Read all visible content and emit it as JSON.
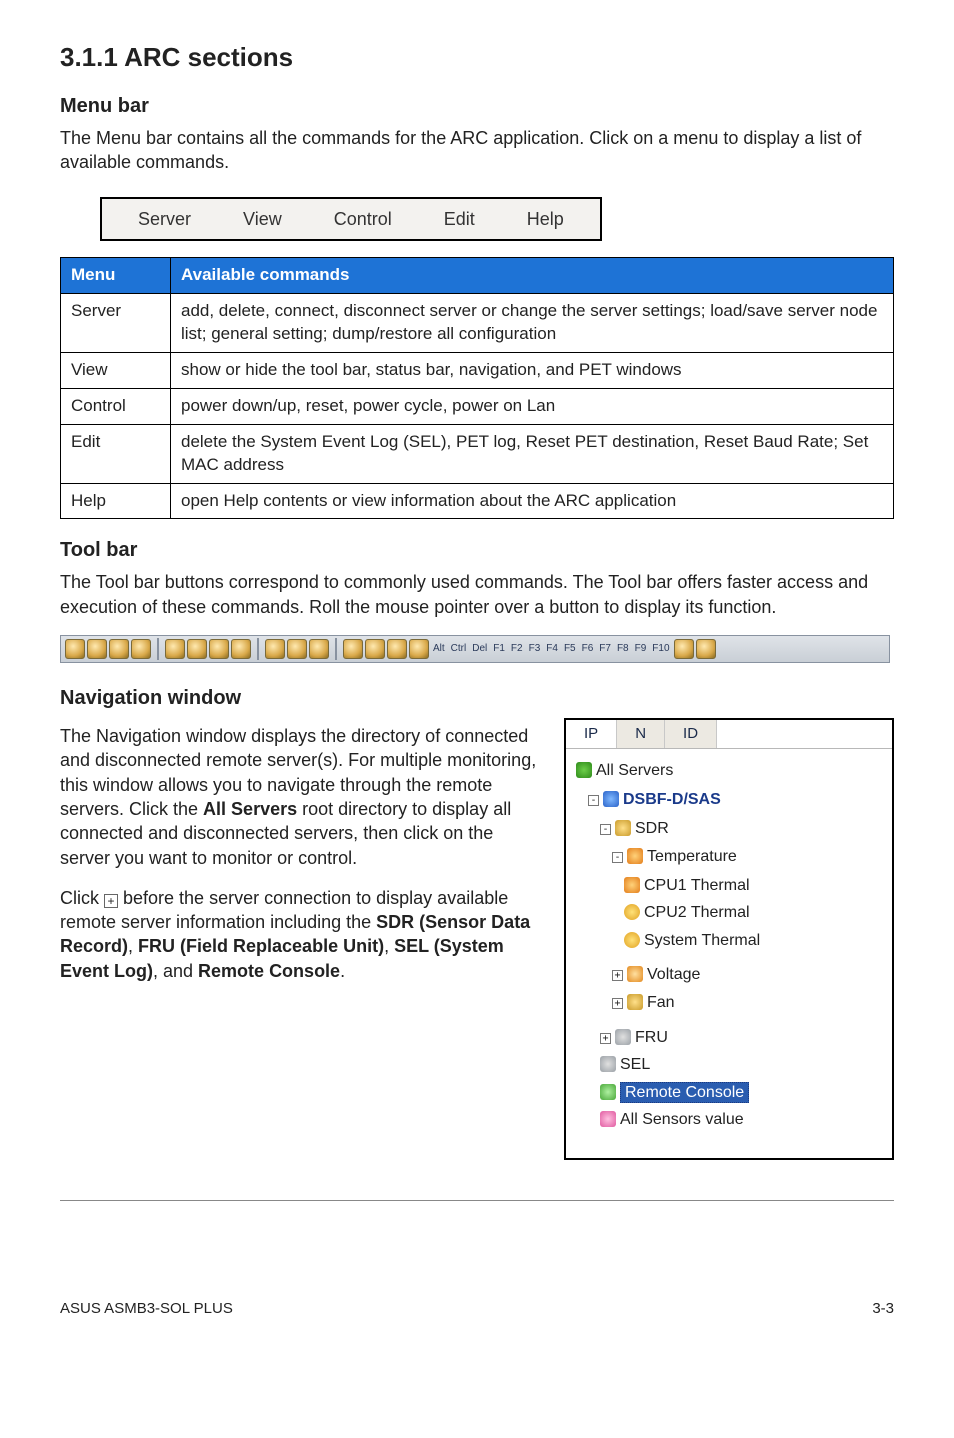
{
  "section": {
    "number_title": "3.1.1    ARC sections"
  },
  "menu_bar": {
    "heading": "Menu bar",
    "intro": "The Menu bar contains all the commands for the ARC application. Click on a menu to display a list of available commands.",
    "items": [
      "Server",
      "View",
      "Control",
      "Edit",
      "Help"
    ]
  },
  "commands_table": {
    "headers": [
      "Menu",
      "Available commands"
    ],
    "rows": [
      {
        "menu": "Server",
        "desc": "add, delete, connect, disconnect server or change the server settings; load/save server node list; general setting; dump/restore all configuration"
      },
      {
        "menu": "View",
        "desc": "show or hide the tool bar, status bar, navigation, and PET windows"
      },
      {
        "menu": "Control",
        "desc": "power down/up, reset, power cycle, power on Lan"
      },
      {
        "menu": "Edit",
        "desc": "delete the System Event Log (SEL), PET log, Reset PET destination, Reset Baud Rate; Set MAC address"
      },
      {
        "menu": "Help",
        "desc": "open Help contents or view information about the ARC application"
      }
    ]
  },
  "tool_bar": {
    "heading": "Tool bar",
    "intro": "The Tool bar buttons correspond to commonly used commands. The Tool bar offers faster access and execution of these commands. Roll the mouse pointer over a button to display its function.",
    "key_labels": [
      "Alt",
      "Ctrl",
      "Del",
      "F1",
      "F2",
      "F3",
      "F4",
      "F5",
      "F6",
      "F7",
      "F8",
      "F9",
      "F10"
    ]
  },
  "navigation": {
    "heading": "Navigation window",
    "para1_prefix": "The Navigation window displays the directory of connected and disconnected remote server(s). For multiple monitoring, this window allows you to navigate through the remote servers. Click the ",
    "para1_bold": "All Servers",
    "para1_suffix": " root directory to display all connected and disconnected servers, then click on the server you want to monitor or control.",
    "para2_prefix": "Click ",
    "para2_mid": " before the server connection to display available remote server information including the ",
    "para2_b1": "SDR (Sensor Data Record)",
    "para2_b2": "FRU (Field Replaceable Unit)",
    "para2_b3": "SEL (System Event Log)",
    "para2_b4": "Remote Console",
    "comma": ", ",
    "and": ", and ",
    "period": "."
  },
  "tree": {
    "tabs": [
      "IP",
      "N",
      "ID"
    ],
    "root": "All Servers",
    "server": "DSBF-D/SAS",
    "sdr": "SDR",
    "temp": "Temperature",
    "cpu1": "CPU1 Thermal",
    "cpu2": "CPU2 Thermal",
    "sys": "System Thermal",
    "voltage": "Voltage",
    "fan": "Fan",
    "fru": "FRU",
    "sel": "SEL",
    "remote": "Remote Console",
    "allsensors": "All Sensors value"
  },
  "footer": {
    "left": "ASUS ASMB3-SOL PLUS",
    "right": "3-3"
  },
  "plus_glyph": "+",
  "minus_glyph": "-"
}
